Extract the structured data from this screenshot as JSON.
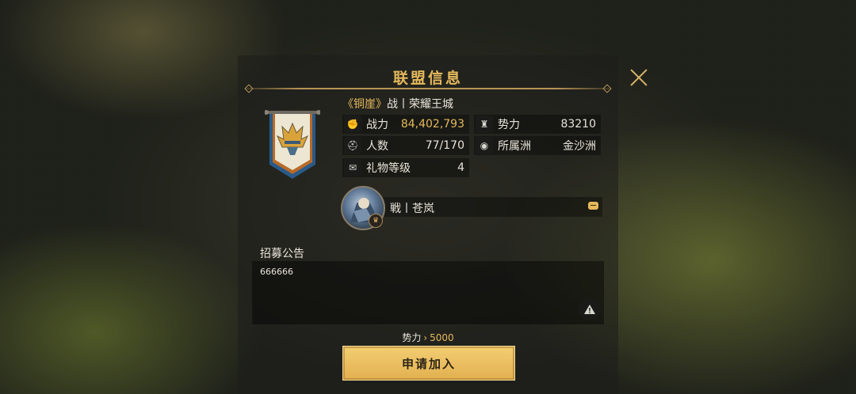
{
  "dialog": {
    "title": "联盟信息"
  },
  "alliance": {
    "tag_open": "《",
    "tag": "铜崖",
    "tag_close": "》",
    "name": "战丨荣耀王城"
  },
  "stats": {
    "power": {
      "label": "战力",
      "value": "84,402,793",
      "icon": "fist-icon"
    },
    "influence": {
      "label": "势力",
      "value": "83210",
      "icon": "fortress-icon"
    },
    "members": {
      "label": "人数",
      "value": "77/170",
      "icon": "helmet-icon"
    },
    "continent": {
      "label": "所属洲",
      "value": "金沙洲",
      "icon": "globe-icon"
    },
    "gift_level": {
      "label": "礼物等级",
      "value": "4",
      "icon": "gift-icon"
    }
  },
  "leader": {
    "name": "戦丨苍岚"
  },
  "recruit": {
    "label": "招募公告",
    "text": "666666"
  },
  "requirement": {
    "label": "势力",
    "value": "5000"
  },
  "join_button": {
    "label": "申请加入"
  },
  "colors": {
    "gold": "#e5b95c",
    "button": "#f0c665"
  }
}
